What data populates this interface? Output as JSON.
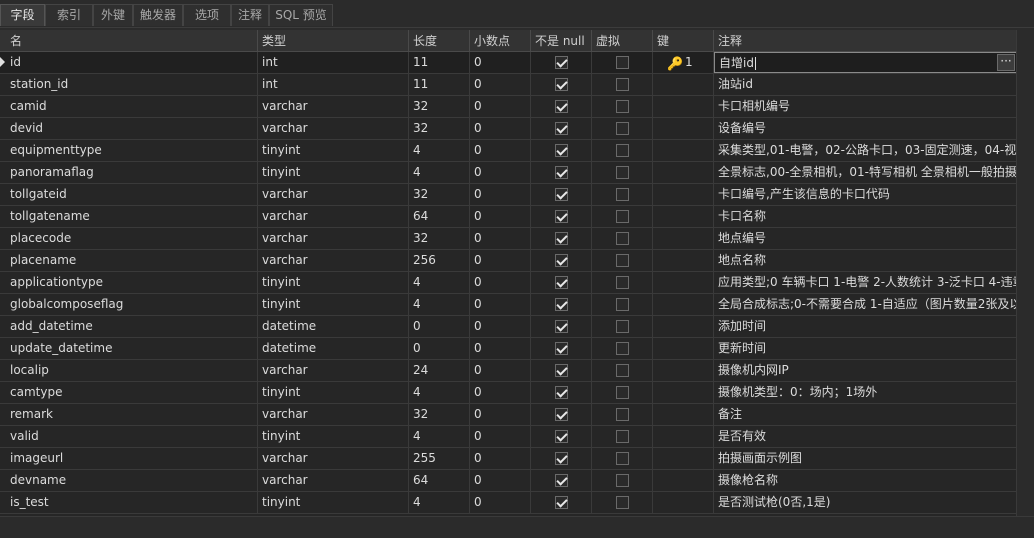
{
  "tabs": [
    {
      "label": "字段",
      "active": true
    },
    {
      "label": "索引"
    },
    {
      "label": "外键"
    },
    {
      "label": "触发器"
    },
    {
      "label": "选项"
    },
    {
      "label": "注释"
    },
    {
      "label": "SQL 预览"
    }
  ],
  "columns": {
    "name": "名",
    "type": "类型",
    "length": "长度",
    "decimals": "小数点",
    "not_null": "不是 null",
    "virtual": "虚拟",
    "key": "键",
    "comment": "注释"
  },
  "rows": [
    {
      "name": "id",
      "type": "int",
      "length": "11",
      "decimals": "0",
      "not_null": true,
      "virtual": false,
      "key": "1",
      "comment": "自增id"
    },
    {
      "name": "station_id",
      "type": "int",
      "length": "11",
      "decimals": "0",
      "not_null": true,
      "virtual": false,
      "key": "",
      "comment": "油站id"
    },
    {
      "name": "camid",
      "type": "varchar",
      "length": "32",
      "decimals": "0",
      "not_null": true,
      "virtual": false,
      "key": "",
      "comment": "卡口相机编号"
    },
    {
      "name": "devid",
      "type": "varchar",
      "length": "32",
      "decimals": "0",
      "not_null": true,
      "virtual": false,
      "key": "",
      "comment": "设备编号"
    },
    {
      "name": "equipmenttype",
      "type": "tinyint",
      "length": "4",
      "decimals": "0",
      "not_null": true,
      "virtual": false,
      "key": "",
      "comment": "采集类型,01-电警，02-公路卡口，03-固定测速，04-视频"
    },
    {
      "name": "panoramaflag",
      "type": "tinyint",
      "length": "4",
      "decimals": "0",
      "not_null": true,
      "virtual": false,
      "key": "",
      "comment": "全景标志,00-全景相机，01-特写相机 全景相机一般拍摄"
    },
    {
      "name": "tollgateid",
      "type": "varchar",
      "length": "32",
      "decimals": "0",
      "not_null": true,
      "virtual": false,
      "key": "",
      "comment": "卡口编号,产生该信息的卡口代码"
    },
    {
      "name": "tollgatename",
      "type": "varchar",
      "length": "64",
      "decimals": "0",
      "not_null": true,
      "virtual": false,
      "key": "",
      "comment": "卡口名称"
    },
    {
      "name": "placecode",
      "type": "varchar",
      "length": "32",
      "decimals": "0",
      "not_null": true,
      "virtual": false,
      "key": "",
      "comment": "地点编号"
    },
    {
      "name": "placename",
      "type": "varchar",
      "length": "256",
      "decimals": "0",
      "not_null": true,
      "virtual": false,
      "key": "",
      "comment": "地点名称"
    },
    {
      "name": "applicationtype",
      "type": "tinyint",
      "length": "4",
      "decimals": "0",
      "not_null": true,
      "virtual": false,
      "key": "",
      "comment": "应用类型;0 车辆卡口 1-电警 2-人数统计 3-泛卡口 4-违章"
    },
    {
      "name": "globalcomposeflag",
      "type": "tinyint",
      "length": "4",
      "decimals": "0",
      "not_null": true,
      "virtual": false,
      "key": "",
      "comment": "全局合成标志;0-不需要合成 1-自适应（图片数量2张及以"
    },
    {
      "name": "add_datetime",
      "type": "datetime",
      "length": "0",
      "decimals": "0",
      "not_null": true,
      "virtual": false,
      "key": "",
      "comment": "添加时间"
    },
    {
      "name": "update_datetime",
      "type": "datetime",
      "length": "0",
      "decimals": "0",
      "not_null": true,
      "virtual": false,
      "key": "",
      "comment": "更新时间"
    },
    {
      "name": "localip",
      "type": "varchar",
      "length": "24",
      "decimals": "0",
      "not_null": true,
      "virtual": false,
      "key": "",
      "comment": "摄像机内网IP"
    },
    {
      "name": "camtype",
      "type": "tinyint",
      "length": "4",
      "decimals": "0",
      "not_null": true,
      "virtual": false,
      "key": "",
      "comment": "摄像机类型：0：场内；1场外"
    },
    {
      "name": "remark",
      "type": "varchar",
      "length": "32",
      "decimals": "0",
      "not_null": true,
      "virtual": false,
      "key": "",
      "comment": "备注"
    },
    {
      "name": "valid",
      "type": "tinyint",
      "length": "4",
      "decimals": "0",
      "not_null": true,
      "virtual": false,
      "key": "",
      "comment": "是否有效"
    },
    {
      "name": "imageurl",
      "type": "varchar",
      "length": "255",
      "decimals": "0",
      "not_null": true,
      "virtual": false,
      "key": "",
      "comment": "拍摄画面示例图"
    },
    {
      "name": "devname",
      "type": "varchar",
      "length": "64",
      "decimals": "0",
      "not_null": true,
      "virtual": false,
      "key": "",
      "comment": "摄像枪名称"
    },
    {
      "name": "is_test",
      "type": "tinyint",
      "length": "4",
      "decimals": "0",
      "not_null": true,
      "virtual": false,
      "key": "",
      "comment": "是否测试枪(0否,1是)"
    }
  ],
  "selected_row": 0,
  "ellipsis_label": "···"
}
